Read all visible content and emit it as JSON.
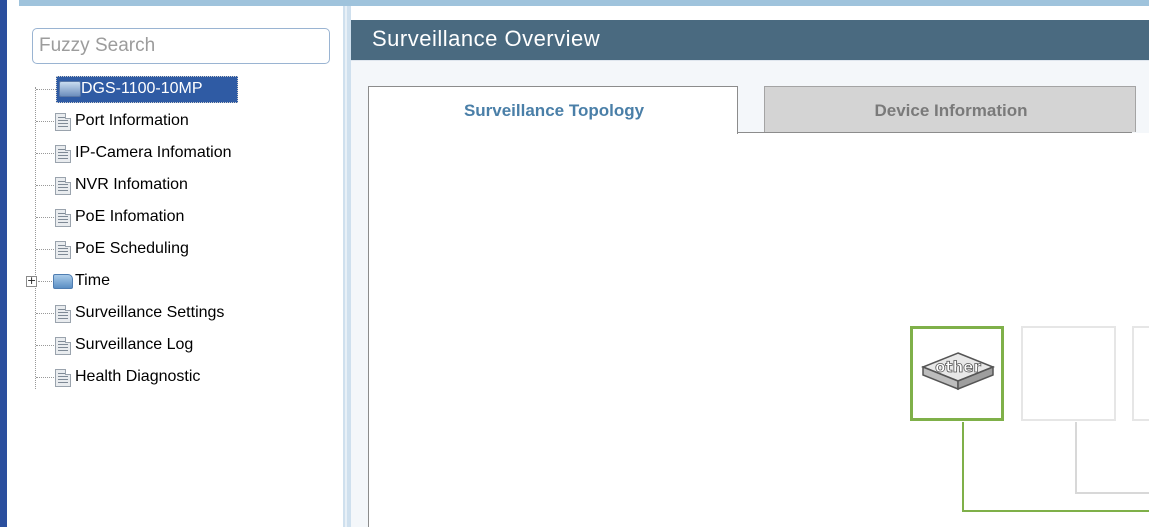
{
  "search": {
    "placeholder": "Fuzzy Search"
  },
  "tree": {
    "root": {
      "label": "DGS-1100-10MP",
      "icon": "switch-icon"
    },
    "items": [
      {
        "label": "Port Information",
        "icon": "document-icon"
      },
      {
        "label": "IP-Camera Infomation",
        "icon": "document-icon"
      },
      {
        "label": "NVR Infomation",
        "icon": "document-icon"
      },
      {
        "label": "PoE Infomation",
        "icon": "document-icon"
      },
      {
        "label": "PoE Scheduling",
        "icon": "document-icon"
      },
      {
        "label": "Time",
        "icon": "folder-icon",
        "expandable": true
      },
      {
        "label": "Surveillance Settings",
        "icon": "document-icon"
      },
      {
        "label": "Surveillance Log",
        "icon": "document-icon"
      },
      {
        "label": "Health Diagnostic",
        "icon": "document-icon"
      }
    ]
  },
  "main": {
    "title": "Surveillance Overview",
    "tabs": [
      {
        "label": "Surveillance Topology",
        "active": true
      },
      {
        "label": "Device Information",
        "active": false
      }
    ],
    "topology": {
      "nodes": [
        {
          "label": "other",
          "icon": "other-device-icon",
          "selected": true
        }
      ]
    }
  },
  "colors": {
    "selection": "#2f5ba4",
    "title_bar": "#4a6a80",
    "active_tab_text": "#4a7fa8",
    "topology_link": "#7fb049"
  }
}
